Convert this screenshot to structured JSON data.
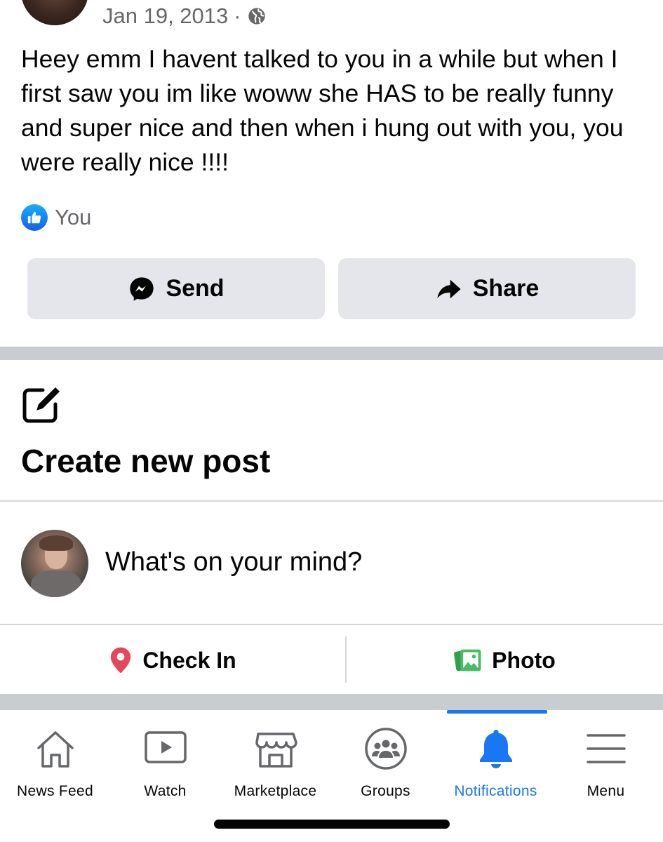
{
  "post": {
    "date": "Jan 19, 2013",
    "separator": "·",
    "text": "Heey emm I havent talked to you in a while but when I first saw you im like woww she HAS to be really funny and super nice and then when i hung out with you, you were really nice !!!!",
    "reactions_label": "You",
    "send_label": "Send",
    "share_label": "Share"
  },
  "create": {
    "title": "Create new post",
    "placeholder": "What's on your mind?",
    "checkin_label": "Check In",
    "photo_label": "Photo"
  },
  "nav": {
    "tabs": [
      {
        "label": "News Feed",
        "icon": "home-icon"
      },
      {
        "label": "Watch",
        "icon": "watch-icon"
      },
      {
        "label": "Marketplace",
        "icon": "marketplace-icon"
      },
      {
        "label": "Groups",
        "icon": "groups-icon"
      },
      {
        "label": "Notifications",
        "icon": "bell-icon",
        "active": true
      },
      {
        "label": "Menu",
        "icon": "menu-icon"
      }
    ]
  },
  "colors": {
    "accent": "#1877f2",
    "button_bg": "#e4e6eb",
    "separator": "#c9ccd1",
    "checkin_pin": "#e4475a",
    "photo_green": "#45bd62"
  }
}
